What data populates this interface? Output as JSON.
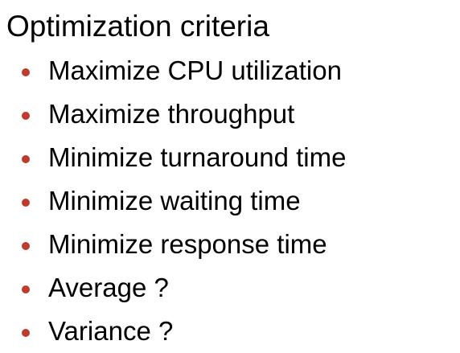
{
  "slide": {
    "title": "Optimization criteria",
    "bullet_color": "#c0392b",
    "bullets": [
      {
        "text": "Maximize CPU utilization"
      },
      {
        "text": "Maximize throughput"
      },
      {
        "text": "Minimize turnaround time"
      },
      {
        "text": "Minimize waiting time"
      },
      {
        "text": "Minimize response time"
      },
      {
        "text": "Average ?"
      },
      {
        "text": "Variance ?"
      }
    ]
  }
}
